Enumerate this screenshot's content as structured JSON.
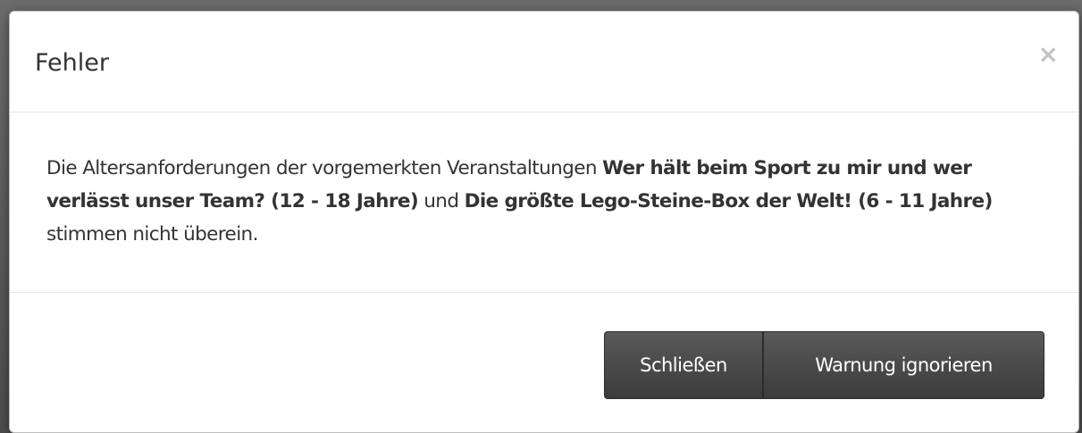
{
  "dialog": {
    "title": "Fehler",
    "close_symbol": "×",
    "message": {
      "part1": "Die Altersanforderungen der vorgemerkten Veranstaltungen ",
      "event1": "Wer hält beim Sport zu mir und wer verlässt unser Team? (12 - 18 Jahre)",
      "part2": " und ",
      "event2": "Die größte Lego-Steine-Box der Welt! (6 - 11 Jahre)",
      "part3": " stimmen nicht überein."
    },
    "buttons": {
      "close_label": "Schließen",
      "ignore_label": "Warnung ignorieren"
    }
  },
  "colors": {
    "button_bg": "#474747",
    "text": "#333333",
    "close_icon": "#c4c4c4"
  }
}
